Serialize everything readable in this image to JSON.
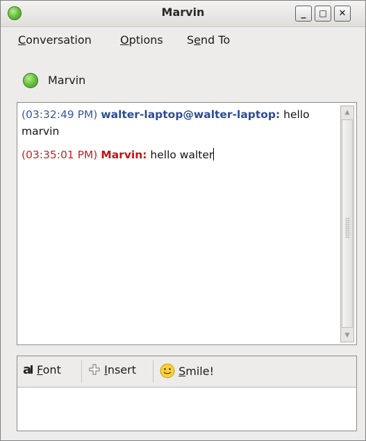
{
  "window": {
    "title": "Marvin",
    "controls": {
      "minimize": "_",
      "maximize": "□",
      "close": "✕"
    }
  },
  "menu": {
    "conversation": {
      "accel": "C",
      "rest": "onversation"
    },
    "options": {
      "accel": "O",
      "rest": "ptions"
    },
    "sendto": {
      "pre": "S",
      "accel": "e",
      "rest": "nd To"
    }
  },
  "contact": {
    "name": "Marvin",
    "status": "available"
  },
  "messages": [
    {
      "time": "(03:32:49 PM)",
      "sender": "walter-laptop@walter-laptop:",
      "text": "hello marvin",
      "color": "#2b4c97"
    },
    {
      "time": "(03:35:01 PM)",
      "sender": "Marvin:",
      "text": "hello walter",
      "color": "#c41212"
    }
  ],
  "toolbar": {
    "font": {
      "accel": "F",
      "rest": "ont"
    },
    "insert": {
      "accel": "I",
      "rest": "nsert"
    },
    "smile": {
      "accel": "S",
      "rest": "mile!"
    }
  },
  "colors": {
    "status_available": "#6cc444",
    "self": "#2b4c97",
    "buddy": "#c41212"
  }
}
